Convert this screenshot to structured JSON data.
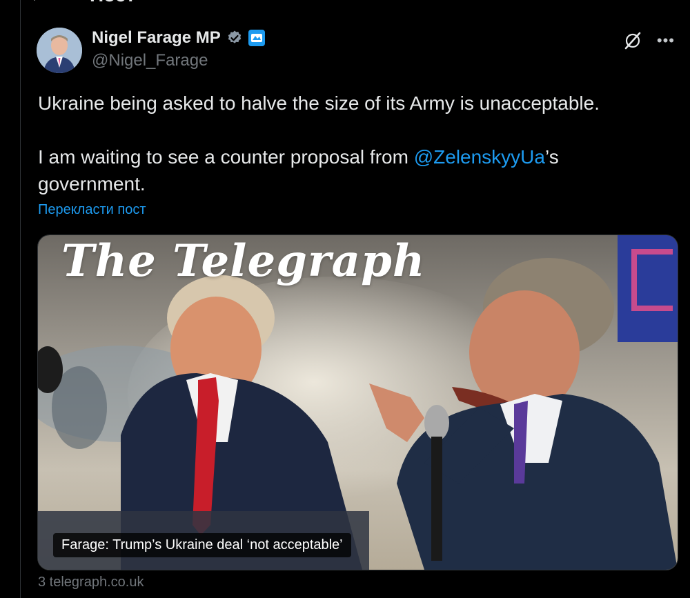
{
  "header": {
    "back_glyph": "←",
    "title": "Пост"
  },
  "author": {
    "name": "Nigel Farage MP",
    "handle": "@Nigel_Farage"
  },
  "tweet": {
    "line1": "Ukraine being asked to halve the size of its Army is unacceptable.",
    "line2_prefix": "I am waiting to see a counter proposal from ",
    "mention": "@ZelenskyyUa",
    "line2_suffix": "’s",
    "line3": "government."
  },
  "translate_label": "Перекласти пост",
  "card": {
    "masthead": "The Telegraph",
    "caption": "Farage: Trump’s Ukraine deal ‘not acceptable’",
    "source": "3 telegraph.co.uk"
  },
  "icons": {
    "verified": "verified-badge-icon",
    "affiliate": "affiliate-badge-icon",
    "grok": "grok-icon",
    "more": "more-icon"
  },
  "colors": {
    "accent": "#1d9bf0",
    "muted": "#71767b",
    "text": "#e7e9ea",
    "background": "#000000"
  }
}
